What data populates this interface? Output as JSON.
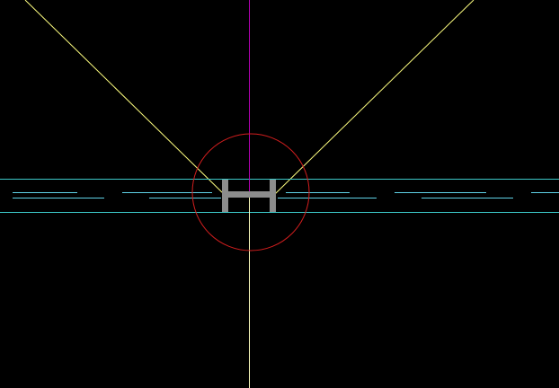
{
  "viewport": {
    "background_color": "#000000"
  },
  "colors": {
    "view_frustum_line": "#ffff80",
    "vertical_axis_upper": "#b400b4",
    "vertical_axis_lower": "#ffffc0",
    "selection_circle": "#d21e1e",
    "road_edge": "#3cc8c8",
    "lane_marking": "#5fd2e6",
    "vehicle_body": "#8c8c8c"
  },
  "icons": {
    "vehicle": "h-shaped-vehicle-icon",
    "selection": "circle-selection-icon",
    "camera_view": "frustum-icon"
  }
}
